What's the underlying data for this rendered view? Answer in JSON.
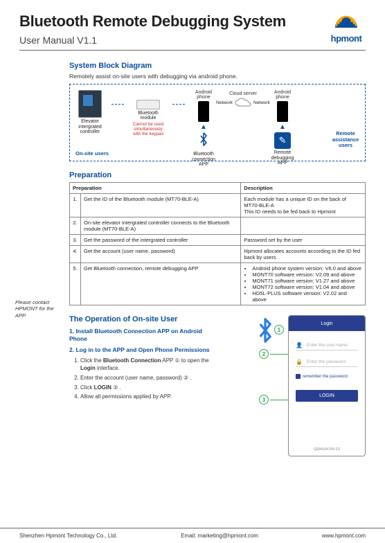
{
  "header": {
    "title": "Bluetooth Remote Debugging System",
    "subtitle": "User Manual V1.1",
    "logo_text": "hpmont"
  },
  "system_block": {
    "title": "System Block Diagram",
    "desc": "Remotely assist on-site users with debugging via android phone.",
    "labels": {
      "controller": "Elevator intergrated controller",
      "bt_module": "Bluetooth module",
      "bt_warning": "Cannot be used simultaneously with the keypad",
      "android": "Android phone",
      "bt_app": "Bluetooth connection APP",
      "cloud": "Cloud server",
      "network": "Network",
      "remote_app": "Remote debugging APP",
      "onsite": "On-site users",
      "remote_users": "Remote assistance users"
    }
  },
  "preparation": {
    "title": "Preparation",
    "col_prep": "Preparation",
    "col_desc": "Description",
    "rows": [
      {
        "n": "1.",
        "prep": "Get the ID of the Bluetooth module (MT70-BLE-A)",
        "desc": "Each module has a unique ID on the back of MT70-BLE-A\nThis ID needs to be fed back to Hpmont"
      },
      {
        "n": "2.",
        "prep": "On-site elevator intergrated controller connects to the Bluetooth module (MT70-BLE-A)",
        "desc": ""
      },
      {
        "n": "3.",
        "prep": "Get the password of the intergrated controller",
        "desc": "Password set by the user"
      },
      {
        "n": "4.",
        "prep": "Get the account (user name, password)",
        "desc": "Hpmont allocates accounts according to the ID fed back by users"
      },
      {
        "n": "5.",
        "prep": "Get Bluetooth connection, remote debugging APP",
        "desc_list": [
          "Android phone system version: V6.0 and above",
          "MONT70 software version: V2.09 and above",
          "MONT71 software version: V1.27 and above",
          "MONT72 software version: V1.04 and above",
          "HD5L-PLUS software version: V2.02 and above"
        ]
      }
    ],
    "sidenote": "Please contact HPMONT for the APP."
  },
  "operation": {
    "title": "The Operation of On-site User",
    "step1_title": "1. Install Bluetooth Connection APP on Android Phone",
    "step2_title": "2. Log in to the APP and Open Phone Permissions",
    "steps": [
      "Click the Bluetooth Connection APP ① to open the Login interface.",
      "Enter the account (user name, password) ② .",
      "Click LOGIN ③ .",
      "Allow all permissions applied by APP."
    ],
    "phone": {
      "header": "Login",
      "username_ph": "Enter the user name",
      "password_ph": "Enter the password",
      "remember": "remember the password",
      "login_btn": "LOGIN",
      "bottom": "QEMU/KVM-13"
    }
  },
  "footer": {
    "company": "Shenzhen Hpmont Technology Co., Ltd.",
    "email": "Email: marketing@hpmont.com",
    "site": "www.hpmont.com"
  }
}
